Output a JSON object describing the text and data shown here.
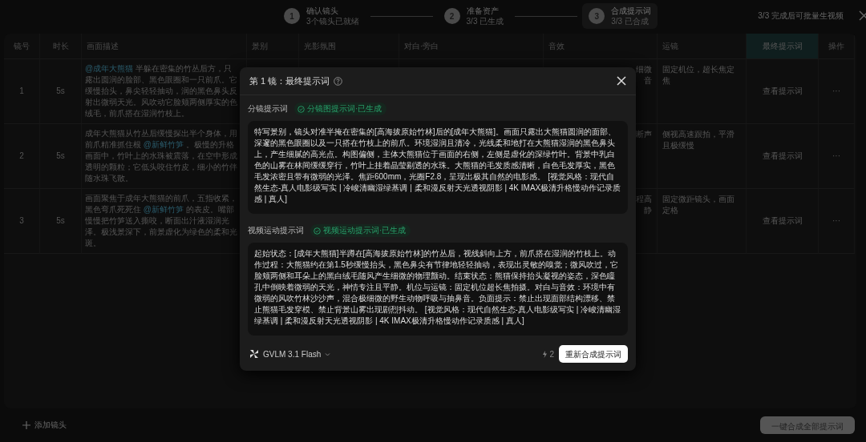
{
  "steps": [
    {
      "number": "1",
      "title": "确认镜头",
      "subtitle": "3个镜头已就绪",
      "selected": false
    },
    {
      "number": "2",
      "title": "准备资产",
      "subtitle": "3/3 已生成",
      "selected": false
    },
    {
      "number": "3",
      "title": "合成提示词",
      "subtitle": "3/3 已合成",
      "selected": true
    }
  ],
  "status_note": "3/3 完成后可批量生视频",
  "table": {
    "columns": [
      {
        "label": "镜号",
        "highlighted": false
      },
      {
        "label": "时长",
        "highlighted": false
      },
      {
        "label": "画面描述",
        "highlighted": false
      },
      {
        "label": "景别",
        "highlighted": false
      },
      {
        "label": "光影氛围",
        "highlighted": false
      },
      {
        "label": "对白·旁白",
        "highlighted": false
      },
      {
        "label": "音效",
        "highlighted": false
      },
      {
        "label": "运镜",
        "highlighted": false
      },
      {
        "label": "最终提示词",
        "highlighted": true
      },
      {
        "label": "操作",
        "highlighted": false
      }
    ],
    "rows": [
      {
        "number": "1",
        "duration": "5s",
        "description": [
          {
            "kind": "mention",
            "text": "@成年大熊猫"
          },
          {
            "kind": "plain",
            "text": " 半躲在密集的竹丛后方，只露出圆润的脸部、黑色眼圈和一只前爪。它缓慢抬头，鼻尖轻轻抽动，润的黑色鼻头反射出微弱天光。风吹动它脸颊两侧厚实的色绒毛，前爪搭在湿润竹枝上。"
          }
        ],
        "sound": [
          "细微",
          "音"
        ],
        "camera": "固定机位，超长焦定焦",
        "prompt_link": "查看提示词",
        "more": "···"
      },
      {
        "number": "2",
        "duration": "5s",
        "description": [
          {
            "kind": "plain",
            "text": "成年大熊猫从竹丛后缓慢探出半个身体，用前爪精准抓住根 "
          },
          {
            "kind": "mention",
            "text": "@新鲜竹笋"
          },
          {
            "kind": "plain",
            "text": " 。极慢的升格画面中，竹叶上的水珠被震落，在空中形成透明的颗粒；它低头咬住竹皮，细小的竹伴随水珠飞散。"
          }
        ],
        "sound": [
          "断声"
        ],
        "camera": "侧视高速跟拍，平滑且极缓慢",
        "prompt_link": "查看提示词",
        "more": "···"
      },
      {
        "number": "3",
        "duration": "5s",
        "description": [
          {
            "kind": "plain",
            "text": "画面聚焦于成年大熊猫的前爪，五指收紧，黑色弯爪死死住 "
          },
          {
            "kind": "mention",
            "text": "@新鲜竹笋"
          },
          {
            "kind": "plain",
            "text": " 的表皮。嘴部慢慢把竹笋送入撕咬，断面出汁液湿润光泽。极浅景深下，前景虚化为绿色的柔和光斑。"
          }
        ],
        "sound": [
          "程高",
          "静"
        ],
        "camera": "固定微距镜头，画面定格",
        "prompt_link": "查看提示词",
        "more": "···"
      }
    ]
  },
  "modal": {
    "title": "第 1 镜：最终提示词",
    "sections": [
      {
        "label": "分镜提示词",
        "badge": "分镜图提示词·已生成",
        "text": "特写景别，镜头对准半掩在密集的[高海拔原始竹林]后的[成年大熊猫]。画面只露出大熊猫圆润的面部、深邃的黑色眼圈以及一只搭在竹枝上的前爪。环境湿润且清冷，光线柔和地打在大熊猫湿润的黑色鼻头上，产生细腻的高光点。构图偏侧，主体大熊猫位于画面的右侧，左侧是虚化的深绿竹叶。背景中乳白色的山雾在林间缓缓穿行，竹叶上挂着晶莹剔透的水珠。大熊猫的毛发质感清晰，白色毛发厚实，黑色毛发浓密且带有微弱的光泽。焦距600mm，光圈F2.8，呈现出极其自然的电影感。 [视觉风格：现代自然生态-真人电影级写实 | 冷峻清幽湿绿基调 | 柔和漫反射天光透视阴影 | 4K IMAX极清升格慢动作记录质感 | 真人]"
      },
      {
        "label": "视频运动提示词",
        "badge": "视频运动提示词·已生成",
        "text": "起始状态：[成年大熊猫]半蹲在[高海拔原始竹林]的竹丛后，视线斜向上方，前爪搭在湿润的竹枝上。动作过程：大熊猫约在第1.5秒缓慢抬头，黑色鼻尖有节律地轻轻抽动，表现出灵敏的嗅觉；微风吹过，它脸颊两侧和耳朵上的黑白绒毛随风产生细微的物理颤动。结束状态：熊猫保持抬头凝视的姿态，深色瞳孔中倒映着微弱的天光，神情专注且平静。机位与运镜：固定机位超长焦拍摄。对白与音效：环境中有微弱的风吹竹林沙沙声，混合极细微的野生动物呼吸与抽鼻音。负面提示：禁止出现面部结构漂移、禁止熊猫毛发穿模、禁止背景山雾出现剧烈抖动。 [视觉风格：现代自然生态-真人电影级写实 | 冷峻清幽湿绿基调 | 柔和漫反射天光透视阴影 | 4K IMAX极清升格慢动作记录质感 | 真人]"
      }
    ],
    "model": "GVLM 3.1 Flash",
    "cost": "2",
    "button": "重新合成提示词"
  },
  "footer": {
    "add_button": "添加镜头",
    "generate_button": "一键合成全部提示词",
    "generate_disabled": true
  }
}
